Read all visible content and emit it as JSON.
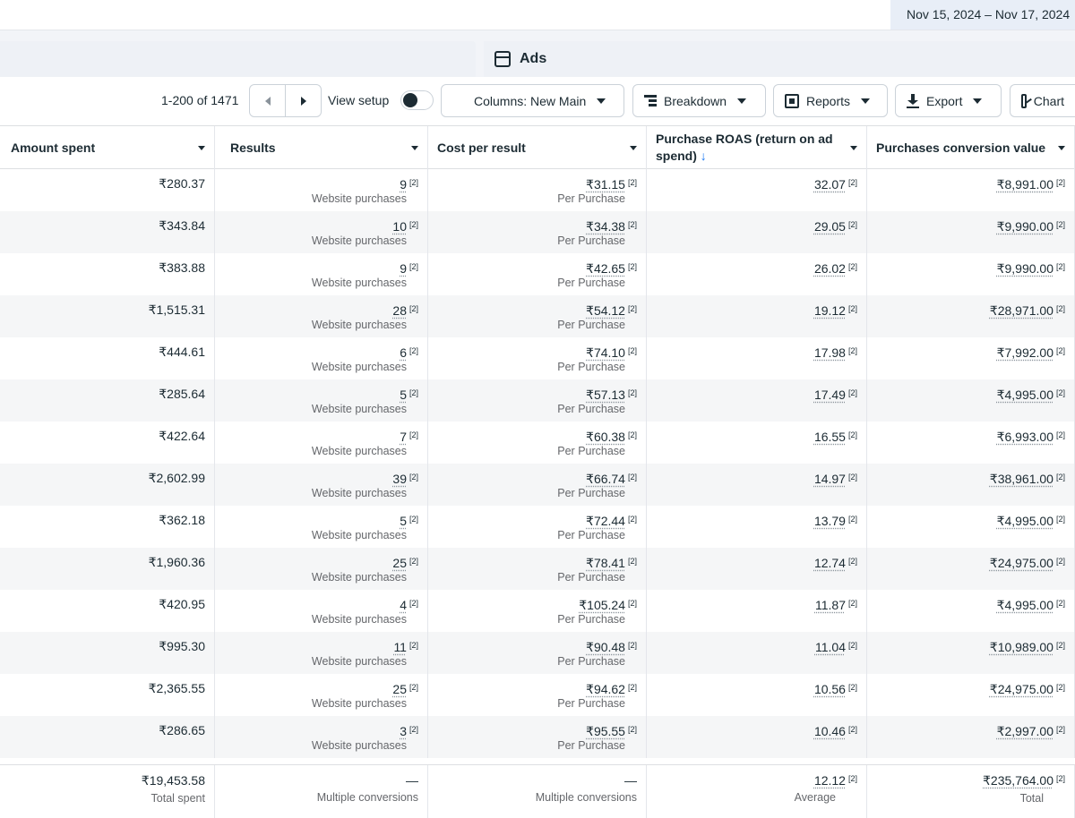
{
  "header": {
    "date_range": "Nov 15, 2024 – Nov 17, 2024",
    "tab_label": "Ads"
  },
  "toolbar": {
    "pager_text": "1-200 of 1471",
    "view_setup_label": "View setup",
    "columns_label": "Columns: New Main",
    "breakdown_label": "Breakdown",
    "reports_label": "Reports",
    "export_label": "Export",
    "chart_label": "Chart"
  },
  "table": {
    "columns": [
      {
        "label": "Amount spent"
      },
      {
        "label": "Results"
      },
      {
        "label": "Cost per result"
      },
      {
        "label": "Purchase ROAS (return on ad spend)",
        "sort": "↓"
      },
      {
        "label": "Purchases conversion value"
      }
    ],
    "note_marker": "[2]",
    "results_sub": "Website purchases",
    "cost_sub": "Per Purchase",
    "rows": [
      {
        "amount": "₹280.37",
        "results": "9",
        "cost": "₹31.15",
        "roas": "32.07",
        "value": "₹8,991.00"
      },
      {
        "amount": "₹343.84",
        "results": "10",
        "cost": "₹34.38",
        "roas": "29.05",
        "value": "₹9,990.00"
      },
      {
        "amount": "₹383.88",
        "results": "9",
        "cost": "₹42.65",
        "roas": "26.02",
        "value": "₹9,990.00"
      },
      {
        "amount": "₹1,515.31",
        "results": "28",
        "cost": "₹54.12",
        "roas": "19.12",
        "value": "₹28,971.00"
      },
      {
        "amount": "₹444.61",
        "results": "6",
        "cost": "₹74.10",
        "roas": "17.98",
        "value": "₹7,992.00"
      },
      {
        "amount": "₹285.64",
        "results": "5",
        "cost": "₹57.13",
        "roas": "17.49",
        "value": "₹4,995.00"
      },
      {
        "amount": "₹422.64",
        "results": "7",
        "cost": "₹60.38",
        "roas": "16.55",
        "value": "₹6,993.00"
      },
      {
        "amount": "₹2,602.99",
        "results": "39",
        "cost": "₹66.74",
        "roas": "14.97",
        "value": "₹38,961.00"
      },
      {
        "amount": "₹362.18",
        "results": "5",
        "cost": "₹72.44",
        "roas": "13.79",
        "value": "₹4,995.00"
      },
      {
        "amount": "₹1,960.36",
        "results": "25",
        "cost": "₹78.41",
        "roas": "12.74",
        "value": "₹24,975.00"
      },
      {
        "amount": "₹420.95",
        "results": "4",
        "cost": "₹105.24",
        "roas": "11.87",
        "value": "₹4,995.00"
      },
      {
        "amount": "₹995.30",
        "results": "11",
        "cost": "₹90.48",
        "roas": "11.04",
        "value": "₹10,989.00"
      },
      {
        "amount": "₹2,365.55",
        "results": "25",
        "cost": "₹94.62",
        "roas": "10.56",
        "value": "₹24,975.00"
      },
      {
        "amount": "₹286.65",
        "results": "3",
        "cost": "₹95.55",
        "roas": "10.46",
        "value": "₹2,997.00"
      }
    ],
    "totals": {
      "amount": "₹19,453.58",
      "amount_sub": "Total spent",
      "results": "—",
      "results_sub": "Multiple conversions",
      "cost": "—",
      "cost_sub": "Multiple conversions",
      "roas": "12.12",
      "roas_sub": "Average",
      "value": "₹235,764.00",
      "value_sub": "Total"
    }
  }
}
